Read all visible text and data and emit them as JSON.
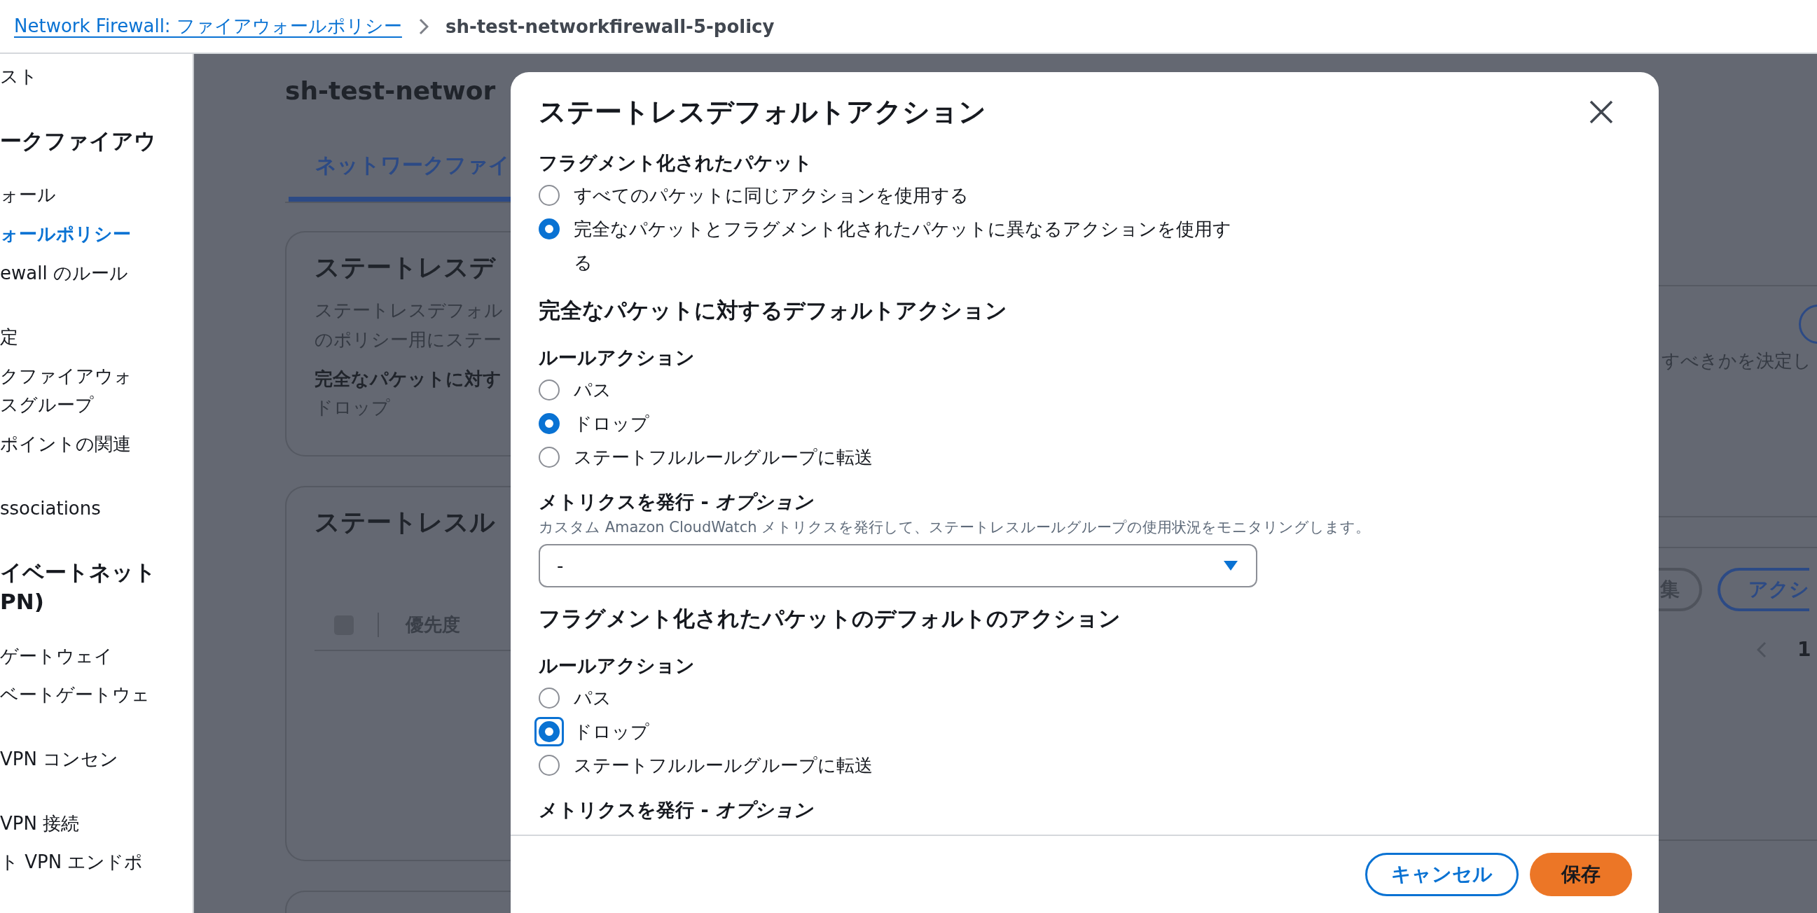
{
  "breadcrumb": {
    "link": "Network Firewall: ファイアウォールポリシー",
    "current": "sh-test-networkfirewall-5-policy"
  },
  "sidebar": {
    "sections": [
      {
        "items": [
          {
            "kind": "link",
            "lines": [
              "スト"
            ],
            "selected": false
          }
        ]
      },
      {
        "items": [
          {
            "kind": "header",
            "lines": [
              "ークファイアウ"
            ]
          },
          {
            "kind": "link",
            "lines": [
              "ォール"
            ],
            "selected": false
          },
          {
            "kind": "link",
            "lines": [
              "ォールポリシー"
            ],
            "selected": true
          },
          {
            "kind": "link",
            "lines": [
              "ewall のルール"
            ],
            "selected": false
          }
        ]
      },
      {
        "items": [
          {
            "kind": "link",
            "lines": [
              "定"
            ],
            "selected": false
          },
          {
            "kind": "link",
            "lines": [
              "クファイアウォ",
              "スグループ"
            ],
            "selected": false
          },
          {
            "kind": "link",
            "lines": [
              "ポイントの関連"
            ],
            "selected": false
          }
        ]
      },
      {
        "items": [
          {
            "kind": "link",
            "lines": [
              "ssociations"
            ],
            "selected": false
          }
        ]
      },
      {
        "items": [
          {
            "kind": "header",
            "lines": [
              "イベートネット",
              "PN)"
            ],
            "selected": false
          },
          {
            "kind": "link",
            "lines": [
              "ゲートウェイ"
            ],
            "selected": false
          },
          {
            "kind": "link",
            "lines": [
              "ベートゲートウェ"
            ],
            "selected": false
          }
        ]
      },
      {
        "items": [
          {
            "kind": "link",
            "lines": [
              "VPN コンセン"
            ],
            "selected": false
          }
        ]
      },
      {
        "items": [
          {
            "kind": "link",
            "lines": [
              "VPN 接続"
            ],
            "selected": false
          },
          {
            "kind": "link",
            "lines": [
              "ト VPN エンドポ"
            ],
            "selected": false
          }
        ]
      }
    ]
  },
  "background": {
    "page_title": "sh-test-networ",
    "tab": "ネットワークファイ",
    "card_1": {
      "heading": "ステートレスデ",
      "description": [
        "ステートレスデフォル",
        "のポリシー用にステー"
      ],
      "description_right": "すべきかを決定し",
      "label": "完全なパケットに対す",
      "value": "ドロップ"
    },
    "card_2": {
      "heading": "ステートレスル",
      "checkbox_checked": false,
      "column": "優先度",
      "buttons": [
        "集",
        "アクシ"
      ],
      "page": "1"
    }
  },
  "modal": {
    "title": "ステートレスデフォルトアクション",
    "fragment_group": {
      "label": "フラグメント化されたパケット",
      "options": [
        {
          "label": "すべてのパケットに同じアクションを使用する",
          "selected": false
        },
        {
          "label": "完全なパケットとフラグメント化されたパケットに異なるアクションを使用する",
          "selected": true
        }
      ]
    },
    "sections": [
      {
        "heading": "完全なパケットに対するデフォルトアクション",
        "rule_label": "ルールアクション",
        "options": [
          {
            "label": "パス",
            "selected": false
          },
          {
            "label": "ドロップ",
            "selected": true
          },
          {
            "label": "ステートフルルールグループに転送",
            "selected": false
          }
        ],
        "metrics": {
          "label": "メトリクスを発行 - *オプション*",
          "description": "カスタム Amazon CloudWatch メトリクスを発行して、ステートレスルールグループの使用状況をモニタリングします。",
          "select_value": "-"
        }
      },
      {
        "heading": "フラグメント化されたパケットのデフォルトのアクション",
        "rule_label": "ルールアクション",
        "options": [
          {
            "label": "パス",
            "selected": false,
            "focused": false
          },
          {
            "label": "ドロップ",
            "selected": true,
            "focused": true
          },
          {
            "label": "ステートフルルールグループに転送",
            "selected": false,
            "focused": false
          }
        ],
        "metrics": {
          "label": "メトリクスを発行 - *オプション*"
        }
      }
    ],
    "buttons": [
      {
        "kind": "secondary",
        "label": "キャンセル"
      },
      {
        "kind": "primary",
        "label": "保存"
      }
    ]
  }
}
